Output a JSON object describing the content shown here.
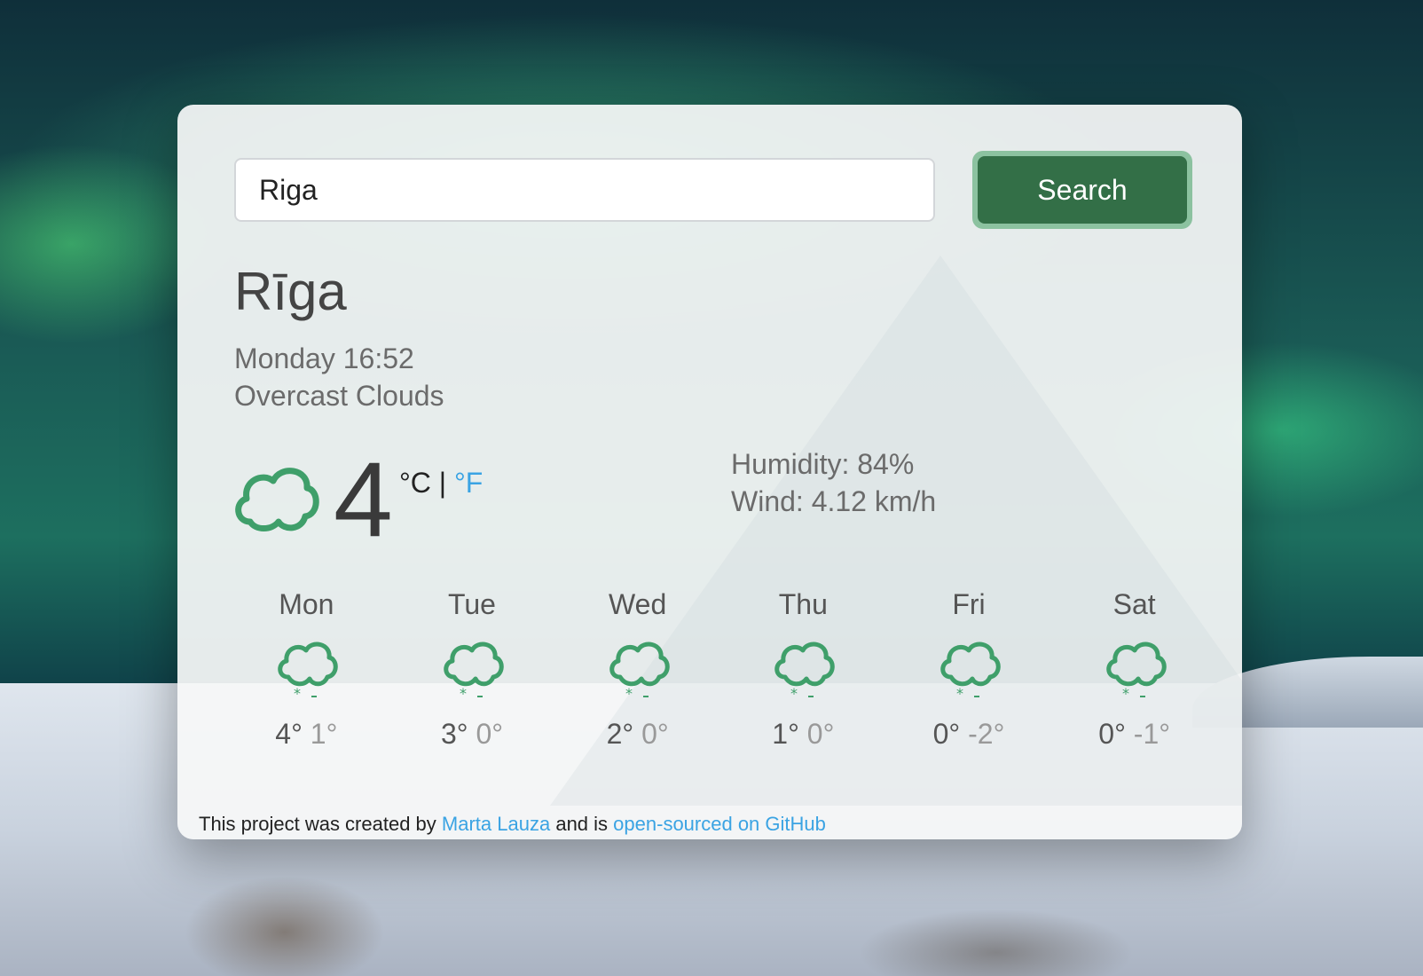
{
  "search": {
    "value": "Riga",
    "button_label": "Search"
  },
  "weather": {
    "city": "Rīga",
    "date": "Monday 16:52",
    "description": "Overcast Clouds",
    "icon": "cloud-icon",
    "temperature": "4",
    "unit_c": "°C",
    "unit_sep": "|",
    "unit_f": "°F",
    "humidity": "Humidity: 84%",
    "wind": "Wind: 4.12 km/h"
  },
  "forecast": [
    {
      "day": "Mon",
      "max": "4°",
      "min": "1°",
      "icon": "snow-cloud-icon"
    },
    {
      "day": "Tue",
      "max": "3°",
      "min": "0°",
      "icon": "snow-cloud-icon"
    },
    {
      "day": "Wed",
      "max": "2°",
      "min": "0°",
      "icon": "snow-cloud-icon"
    },
    {
      "day": "Thu",
      "max": "1°",
      "min": "0°",
      "icon": "snow-cloud-icon"
    },
    {
      "day": "Fri",
      "max": "0°",
      "min": "-2°",
      "icon": "snow-cloud-icon"
    },
    {
      "day": "Sat",
      "max": "0°",
      "min": "-1°",
      "icon": "snow-cloud-icon"
    }
  ],
  "footer": {
    "prefix": "This project was created by",
    "author": "Marta Lauza",
    "middle": "and is",
    "repo_link": "open-sourced on GitHub"
  },
  "colors": {
    "accent_green": "#336f47",
    "link_blue": "#3aa3e3",
    "icon_green": "#3f9f6a"
  }
}
